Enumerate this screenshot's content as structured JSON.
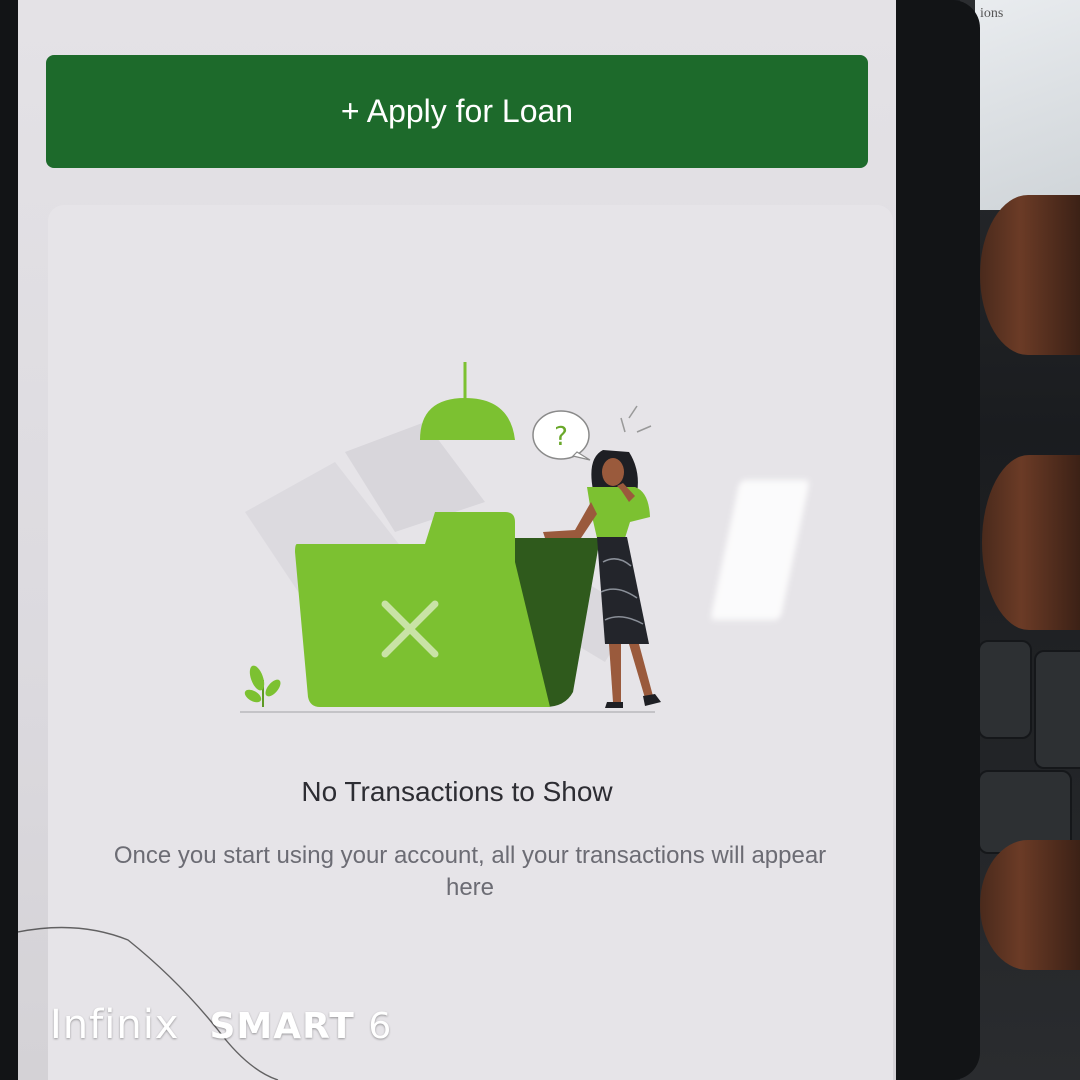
{
  "apply_button": {
    "label": "+ Apply for Loan"
  },
  "empty_state": {
    "title": "No Transactions to Show",
    "subtitle": "Once you start using your account, all your transactions will appear here",
    "question_mark": "?"
  },
  "watermark": {
    "brand": "Infinix",
    "model": "SMART",
    "model_number": "6"
  },
  "background_paper_text": "ions",
  "colors": {
    "primary": "#1d6a2b",
    "illustration_green": "#7cc131",
    "illustration_dark_green": "#2f5a1c"
  },
  "icons": [
    "x-mark-icon",
    "question-bubble-icon",
    "lamp-icon",
    "plant-icon"
  ]
}
